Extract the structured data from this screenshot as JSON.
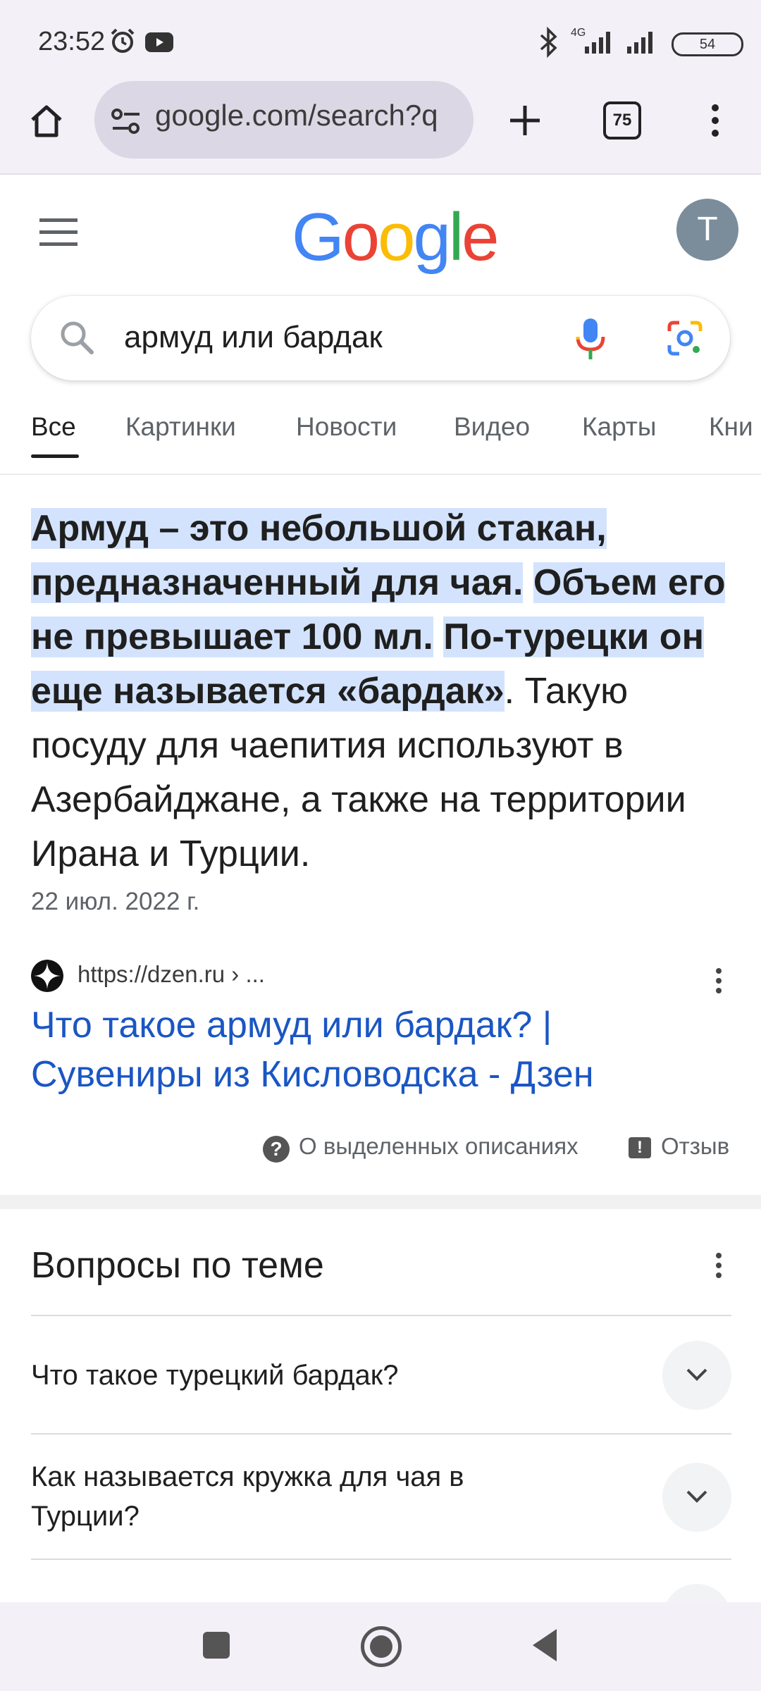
{
  "status_bar": {
    "time": "23:52",
    "battery": "54",
    "network": "4G",
    "icons": [
      "alarm-icon",
      "youtube-icon",
      "bluetooth-icon",
      "signal-icon",
      "signal-icon",
      "battery-icon"
    ]
  },
  "browser": {
    "url": "google.com/search?q",
    "tab_count": "75",
    "icons": [
      "home-icon",
      "site-settings-icon",
      "new-tab-icon",
      "tab-switcher-icon",
      "menu-icon"
    ]
  },
  "google": {
    "logo_letters": [
      {
        "ch": "G",
        "color": "#4285F4"
      },
      {
        "ch": "o",
        "color": "#EA4335"
      },
      {
        "ch": "o",
        "color": "#FBBC05"
      },
      {
        "ch": "g",
        "color": "#4285F4"
      },
      {
        "ch": "l",
        "color": "#34A853"
      },
      {
        "ch": "e",
        "color": "#EA4335"
      }
    ],
    "avatar_letter": "T",
    "query": "армуд или бардак"
  },
  "tabs": [
    {
      "label": "Все",
      "active": true
    },
    {
      "label": "Картинки"
    },
    {
      "label": "Новости"
    },
    {
      "label": "Видео"
    },
    {
      "label": "Карты"
    },
    {
      "label": "Кни"
    }
  ],
  "snippet": {
    "hl1": "Армуд – это небольшой стакан, предназначенный для чая.",
    "hl2": "Объем его не превышает 100 мл.",
    "hl3": "По-турецки он еще называется «бардак»",
    "rest": ". Такую посуду для чаепития используют в Азербайджане, а также на территории Ирана и Турции.",
    "date": "22 июл. 2022 г.",
    "source_url": "https://dzen.ru › ...",
    "result_title": "Что такое армуд или бардак? | Сувениры из Кисловодска - Дзен",
    "about_label": "О выделенных описаниях",
    "feedback_label": "Отзыв"
  },
  "paa": {
    "title": "Вопросы по теме",
    "questions": [
      "Что такое турецкий бардак?",
      "Как называется кружка для чая в Турции?"
    ]
  },
  "colors": {
    "highlight": "#d3e3fd",
    "link": "#1a56c4",
    "chrome_bg": "#f3f0f8"
  }
}
